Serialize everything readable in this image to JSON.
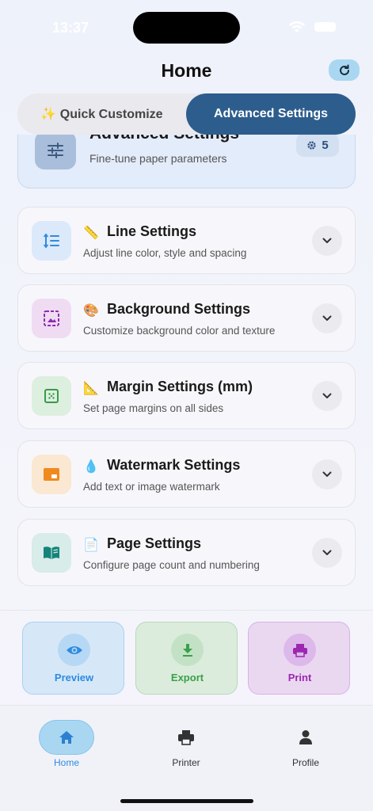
{
  "status_bar": {
    "time": "13:37"
  },
  "header": {
    "title": "Home"
  },
  "segmented": {
    "quick_label": "✨ Quick Customize",
    "advanced_label": "Advanced Settings"
  },
  "advanced_card": {
    "title": "Advanced Settings",
    "subtitle": "Fine-tune paper parameters",
    "count": "5"
  },
  "sections": [
    {
      "emoji": "📏",
      "title": "Line Settings",
      "subtitle": "Adjust line color, style and spacing"
    },
    {
      "emoji": "🎨",
      "title": "Background Settings",
      "subtitle": "Customize background color and texture"
    },
    {
      "emoji": "📐",
      "title": "Margin Settings (mm)",
      "subtitle": "Set page margins on all sides"
    },
    {
      "emoji": "💧",
      "title": "Watermark Settings",
      "subtitle": "Add text or image watermark"
    },
    {
      "emoji": "📄",
      "title": "Page Settings",
      "subtitle": "Configure page count and numbering"
    }
  ],
  "actions": {
    "preview": "Preview",
    "export": "Export",
    "print": "Print"
  },
  "tabs": {
    "home": "Home",
    "printer": "Printer",
    "profile": "Profile"
  },
  "colors": {
    "accent": "#2d5d8d",
    "line": "#2d8be0",
    "background": "#8e2bb0",
    "margin": "#3a9a4a",
    "watermark": "#f08a1e",
    "page": "#14847a",
    "preview": "#2d8be0",
    "export": "#3aa04a",
    "print": "#9c27b0"
  }
}
